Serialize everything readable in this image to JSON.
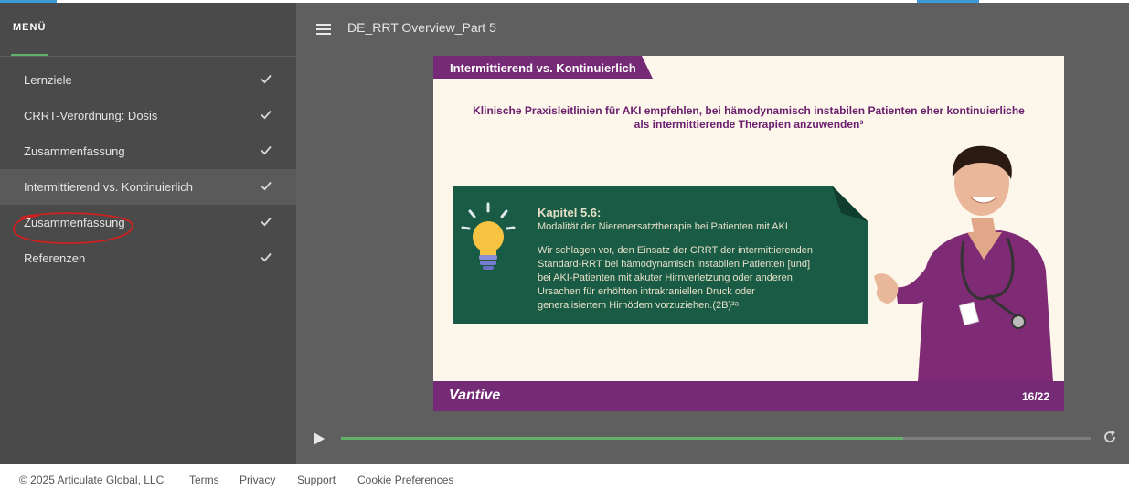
{
  "colors": {
    "sidebar_bg": "#4a4a4a",
    "main_bg": "#5f5f5f",
    "accent_green": "#63b06c",
    "slide_purple": "#742a74",
    "headline_purple": "#6b1f6e",
    "box_green": "#1a5b45",
    "annotation_red": "#cc2222"
  },
  "sidebar": {
    "title": "MENÜ",
    "items": [
      {
        "label": "Lernziele",
        "completed": true,
        "icon": "check-icon"
      },
      {
        "label": "CRRT-Verordnung: Dosis",
        "completed": true,
        "icon": "check-icon"
      },
      {
        "label": "Zusammenfassung",
        "completed": true,
        "icon": "check-icon"
      },
      {
        "label": "Intermittierend vs. Kontinuierlich",
        "completed": true,
        "active": true,
        "icon": "check-icon"
      },
      {
        "label": "Zusammenfassung",
        "completed": true,
        "icon": "check-icon",
        "annotated": true
      },
      {
        "label": "Referenzen",
        "completed": true,
        "icon": "check-icon"
      }
    ]
  },
  "header": {
    "menu_icon": "hamburger-icon",
    "course_title": "DE_RRT Overview_Part 5"
  },
  "slide": {
    "tab_title": "Intermittierend vs. Kontinuierlich",
    "headline_line1": "Klinische Praxisleitlinien für AKI empfehlen, bei hämodynamisch instabilen Patienten eher kontinuierliche",
    "headline_line2": "als intermittierende Therapien anzuwenden³",
    "box": {
      "icon": "lightbulb-icon",
      "title": "Kapitel 5.6:",
      "subtitle": "Modalität der Nierenersatztherapie bei Patienten mit AKI",
      "body_lines": [
        "Wir schlagen vor, den Einsatz der CRRT der intermittierenden",
        "Standard-RRT bei hämodynamisch instabilen Patienten [und]",
        "bei AKI-Patienten mit akuter Hirnverletzung oder anderen",
        "Ursachen für erhöhten intrakraniellen Druck oder",
        "generalisiertem Hirnödem vorzuziehen.(2B)³ᵃ"
      ]
    },
    "image": "doctor-illustration",
    "logo": "Vantive",
    "page_number": "16/22"
  },
  "player": {
    "play_icon": "play-icon",
    "replay_icon": "replay-icon",
    "progress": 0.75
  },
  "footer": {
    "copyright": "© 2025 Articulate Global, LLC",
    "links": [
      "Terms",
      "Privacy",
      "Support",
      "Cookie Preferences"
    ]
  }
}
